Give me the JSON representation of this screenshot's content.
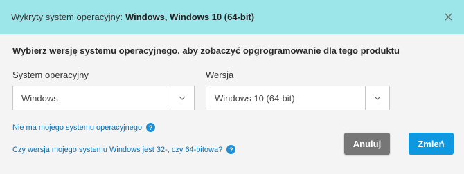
{
  "banner": {
    "detected_label": "Wykryty system operacyjny:",
    "detected_value": "Windows, Windows 10 (64-bit)",
    "close_icon": "close-icon"
  },
  "heading": "Wybierz wersję systemu operacyjnego, aby zobaczyć opgrogramowanie dla tego produktu",
  "os_select": {
    "label": "System operacyjny",
    "value": "Windows",
    "icon": "chevron-down-icon"
  },
  "version_select": {
    "label": "Wersja",
    "value": "Windows 10 (64-bit)",
    "icon": "chevron-down-icon"
  },
  "links": {
    "no_os": "Nie ma mojego systemu operacyjnego",
    "bitness": "Czy wersja mojego systemu Windows jest 32-, czy 64-bitowa?",
    "help_icon": "help-icon",
    "help_glyph": "?"
  },
  "buttons": {
    "cancel": "Anuluj",
    "change": "Zmień"
  },
  "colors": {
    "banner": "#9ce6ea",
    "primary": "#0d98e0",
    "secondary": "#767676",
    "link": "#0b6fb0"
  }
}
